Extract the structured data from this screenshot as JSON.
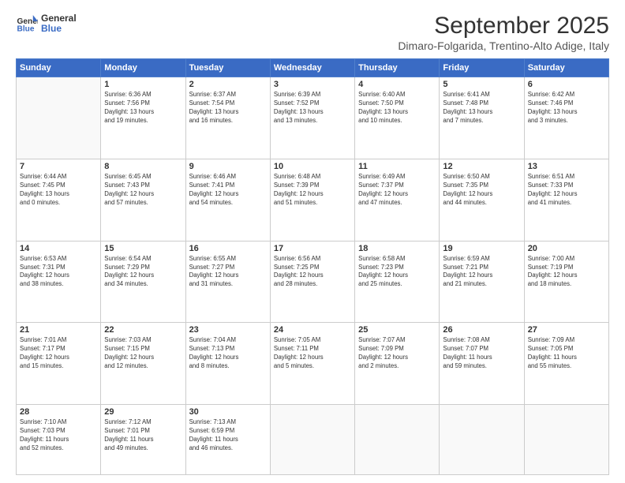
{
  "header": {
    "logo_line1": "General",
    "logo_line2": "Blue",
    "month": "September 2025",
    "location": "Dimaro-Folgarida, Trentino-Alto Adige, Italy"
  },
  "weekdays": [
    "Sunday",
    "Monday",
    "Tuesday",
    "Wednesday",
    "Thursday",
    "Friday",
    "Saturday"
  ],
  "weeks": [
    [
      {
        "day": "",
        "info": ""
      },
      {
        "day": "1",
        "info": "Sunrise: 6:36 AM\nSunset: 7:56 PM\nDaylight: 13 hours\nand 19 minutes."
      },
      {
        "day": "2",
        "info": "Sunrise: 6:37 AM\nSunset: 7:54 PM\nDaylight: 13 hours\nand 16 minutes."
      },
      {
        "day": "3",
        "info": "Sunrise: 6:39 AM\nSunset: 7:52 PM\nDaylight: 13 hours\nand 13 minutes."
      },
      {
        "day": "4",
        "info": "Sunrise: 6:40 AM\nSunset: 7:50 PM\nDaylight: 13 hours\nand 10 minutes."
      },
      {
        "day": "5",
        "info": "Sunrise: 6:41 AM\nSunset: 7:48 PM\nDaylight: 13 hours\nand 7 minutes."
      },
      {
        "day": "6",
        "info": "Sunrise: 6:42 AM\nSunset: 7:46 PM\nDaylight: 13 hours\nand 3 minutes."
      }
    ],
    [
      {
        "day": "7",
        "info": "Sunrise: 6:44 AM\nSunset: 7:45 PM\nDaylight: 13 hours\nand 0 minutes."
      },
      {
        "day": "8",
        "info": "Sunrise: 6:45 AM\nSunset: 7:43 PM\nDaylight: 12 hours\nand 57 minutes."
      },
      {
        "day": "9",
        "info": "Sunrise: 6:46 AM\nSunset: 7:41 PM\nDaylight: 12 hours\nand 54 minutes."
      },
      {
        "day": "10",
        "info": "Sunrise: 6:48 AM\nSunset: 7:39 PM\nDaylight: 12 hours\nand 51 minutes."
      },
      {
        "day": "11",
        "info": "Sunrise: 6:49 AM\nSunset: 7:37 PM\nDaylight: 12 hours\nand 47 minutes."
      },
      {
        "day": "12",
        "info": "Sunrise: 6:50 AM\nSunset: 7:35 PM\nDaylight: 12 hours\nand 44 minutes."
      },
      {
        "day": "13",
        "info": "Sunrise: 6:51 AM\nSunset: 7:33 PM\nDaylight: 12 hours\nand 41 minutes."
      }
    ],
    [
      {
        "day": "14",
        "info": "Sunrise: 6:53 AM\nSunset: 7:31 PM\nDaylight: 12 hours\nand 38 minutes."
      },
      {
        "day": "15",
        "info": "Sunrise: 6:54 AM\nSunset: 7:29 PM\nDaylight: 12 hours\nand 34 minutes."
      },
      {
        "day": "16",
        "info": "Sunrise: 6:55 AM\nSunset: 7:27 PM\nDaylight: 12 hours\nand 31 minutes."
      },
      {
        "day": "17",
        "info": "Sunrise: 6:56 AM\nSunset: 7:25 PM\nDaylight: 12 hours\nand 28 minutes."
      },
      {
        "day": "18",
        "info": "Sunrise: 6:58 AM\nSunset: 7:23 PM\nDaylight: 12 hours\nand 25 minutes."
      },
      {
        "day": "19",
        "info": "Sunrise: 6:59 AM\nSunset: 7:21 PM\nDaylight: 12 hours\nand 21 minutes."
      },
      {
        "day": "20",
        "info": "Sunrise: 7:00 AM\nSunset: 7:19 PM\nDaylight: 12 hours\nand 18 minutes."
      }
    ],
    [
      {
        "day": "21",
        "info": "Sunrise: 7:01 AM\nSunset: 7:17 PM\nDaylight: 12 hours\nand 15 minutes."
      },
      {
        "day": "22",
        "info": "Sunrise: 7:03 AM\nSunset: 7:15 PM\nDaylight: 12 hours\nand 12 minutes."
      },
      {
        "day": "23",
        "info": "Sunrise: 7:04 AM\nSunset: 7:13 PM\nDaylight: 12 hours\nand 8 minutes."
      },
      {
        "day": "24",
        "info": "Sunrise: 7:05 AM\nSunset: 7:11 PM\nDaylight: 12 hours\nand 5 minutes."
      },
      {
        "day": "25",
        "info": "Sunrise: 7:07 AM\nSunset: 7:09 PM\nDaylight: 12 hours\nand 2 minutes."
      },
      {
        "day": "26",
        "info": "Sunrise: 7:08 AM\nSunset: 7:07 PM\nDaylight: 11 hours\nand 59 minutes."
      },
      {
        "day": "27",
        "info": "Sunrise: 7:09 AM\nSunset: 7:05 PM\nDaylight: 11 hours\nand 55 minutes."
      }
    ],
    [
      {
        "day": "28",
        "info": "Sunrise: 7:10 AM\nSunset: 7:03 PM\nDaylight: 11 hours\nand 52 minutes."
      },
      {
        "day": "29",
        "info": "Sunrise: 7:12 AM\nSunset: 7:01 PM\nDaylight: 11 hours\nand 49 minutes."
      },
      {
        "day": "30",
        "info": "Sunrise: 7:13 AM\nSunset: 6:59 PM\nDaylight: 11 hours\nand 46 minutes."
      },
      {
        "day": "",
        "info": ""
      },
      {
        "day": "",
        "info": ""
      },
      {
        "day": "",
        "info": ""
      },
      {
        "day": "",
        "info": ""
      }
    ]
  ]
}
